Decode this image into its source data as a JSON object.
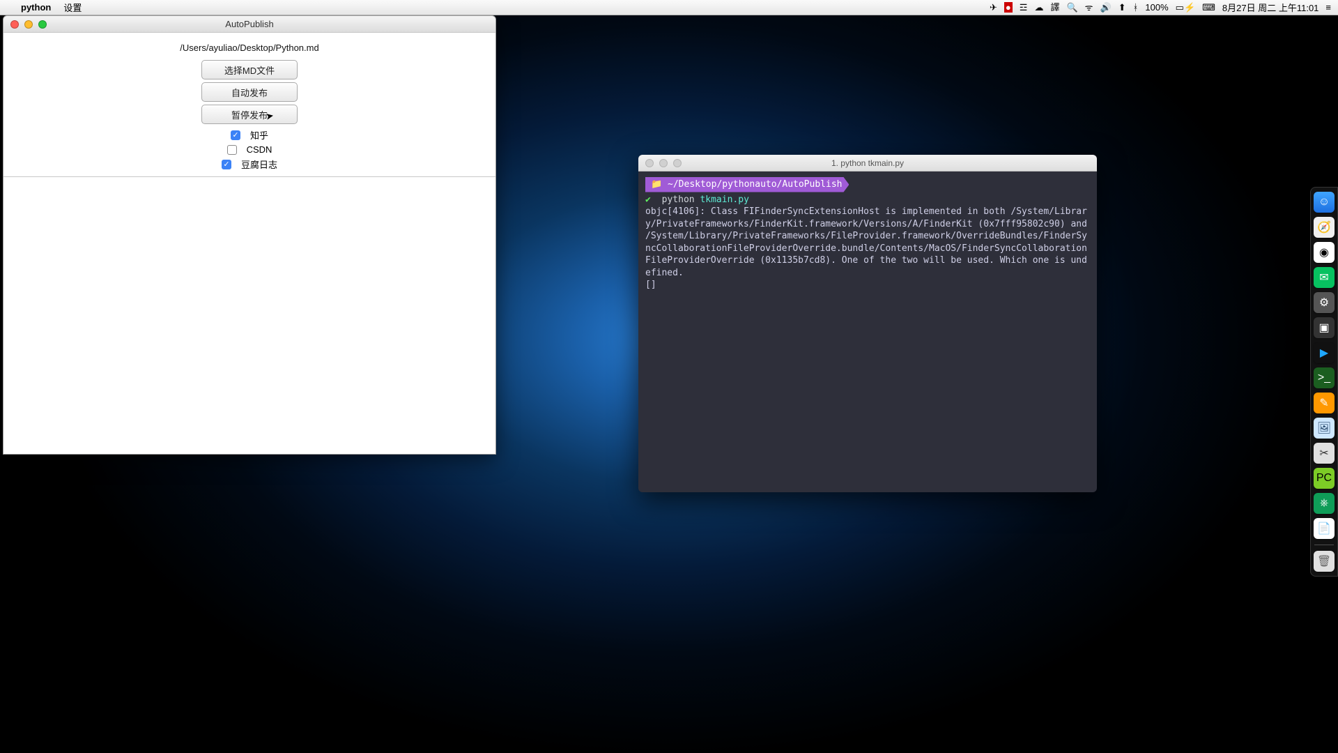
{
  "menubar": {
    "app_name": "python",
    "menu_item_1": "设置",
    "battery": "100%",
    "date": "8月27日 周二 上午11:01"
  },
  "autopublish": {
    "window_title": "AutoPublish",
    "file_path": "/Users/ayuliao/Desktop/Python.md",
    "btn_select_md": "选择MD文件",
    "btn_auto_publish": "自动发布",
    "btn_pause_publish": "暂停发布",
    "checkboxes": [
      {
        "label": "知乎",
        "checked": true
      },
      {
        "label": "CSDN",
        "checked": false
      },
      {
        "label": "豆腐日志",
        "checked": true
      }
    ]
  },
  "terminal": {
    "window_title": "1. python tkmain.py",
    "prompt_path": "~/Desktop/pythonauto/AutoPublish",
    "prompt_cmd": "python",
    "prompt_arg": "tkmain.py",
    "output": "objc[4106]: Class FIFinderSyncExtensionHost is implemented in both /System/Library/PrivateFrameworks/FinderKit.framework/Versions/A/FinderKit (0x7fff95802c90) and /System/Library/PrivateFrameworks/FileProvider.framework/OverrideBundles/FinderSyncCollaborationFileProviderOverride.bundle/Contents/MacOS/FinderSyncCollaborationFileProviderOverride (0x1135b7cd8). One of the two will be used. Which one is undefined.",
    "cursor": "[]"
  },
  "dock": {
    "items": [
      "finder",
      "safari",
      "chrome",
      "wechat",
      "system-preferences",
      "app-store",
      "media-player",
      "terminal",
      "sublime",
      "preview",
      "utility",
      "pycharm",
      "green-app",
      "document"
    ],
    "trash": "trash"
  }
}
